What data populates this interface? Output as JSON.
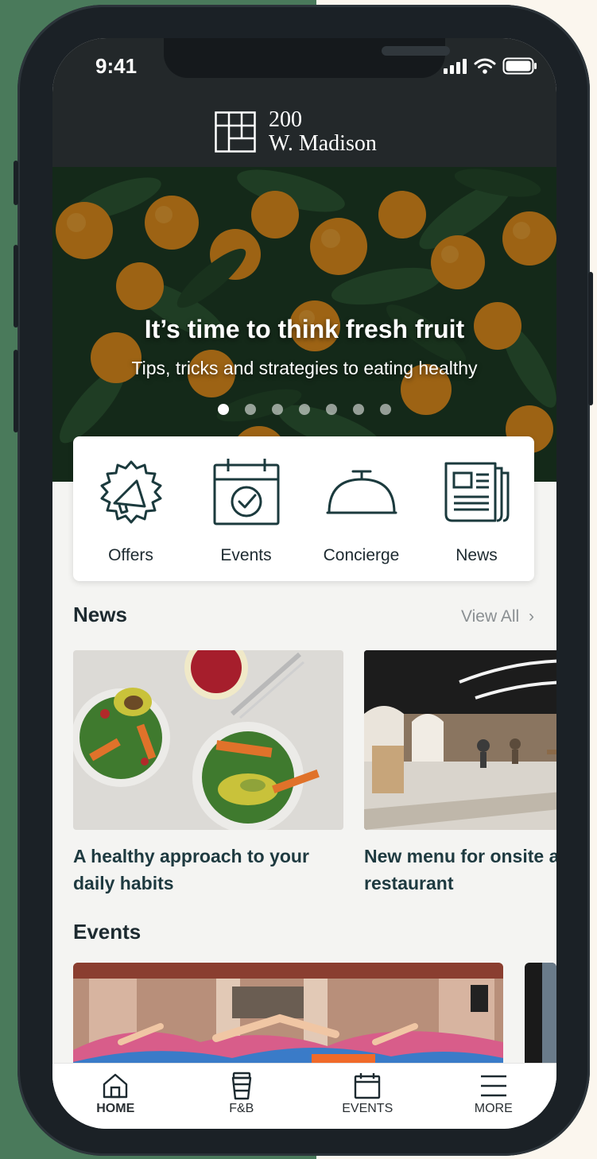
{
  "status_bar": {
    "time": "9:41"
  },
  "brand": {
    "line1": "200",
    "line2": "W. Madison"
  },
  "hero": {
    "title": "It’s time to think fresh fruit",
    "subtitle": "Tips, tricks and strategies to eating healthy",
    "slide_count": 7,
    "active_slide": 1
  },
  "quick_actions": [
    {
      "label": "Offers",
      "icon": "megaphone-badge-icon"
    },
    {
      "label": "Events",
      "icon": "calendar-check-icon"
    },
    {
      "label": "Concierge",
      "icon": "service-bell-icon"
    },
    {
      "label": "News",
      "icon": "newspaper-icon"
    }
  ],
  "news": {
    "section_title": "News",
    "view_all_label": "View All",
    "items": [
      {
        "title": "A healthy approach to your daily habits"
      },
      {
        "title": "New menu for onsite and restaurant"
      }
    ]
  },
  "events": {
    "section_title": "Events"
  },
  "tab_bar": {
    "active": "HOME",
    "tabs": [
      {
        "label": "HOME",
        "icon": "home-icon"
      },
      {
        "label": "F&B",
        "icon": "coffee-cup-icon"
      },
      {
        "label": "EVENTS",
        "icon": "calendar-icon"
      },
      {
        "label": "MORE",
        "icon": "menu-icon"
      }
    ]
  },
  "colors": {
    "header": "#23282a",
    "icon_stroke": "#1b3a3d",
    "background_green": "#4a7a5b",
    "background_cream": "#fbf6ee"
  }
}
